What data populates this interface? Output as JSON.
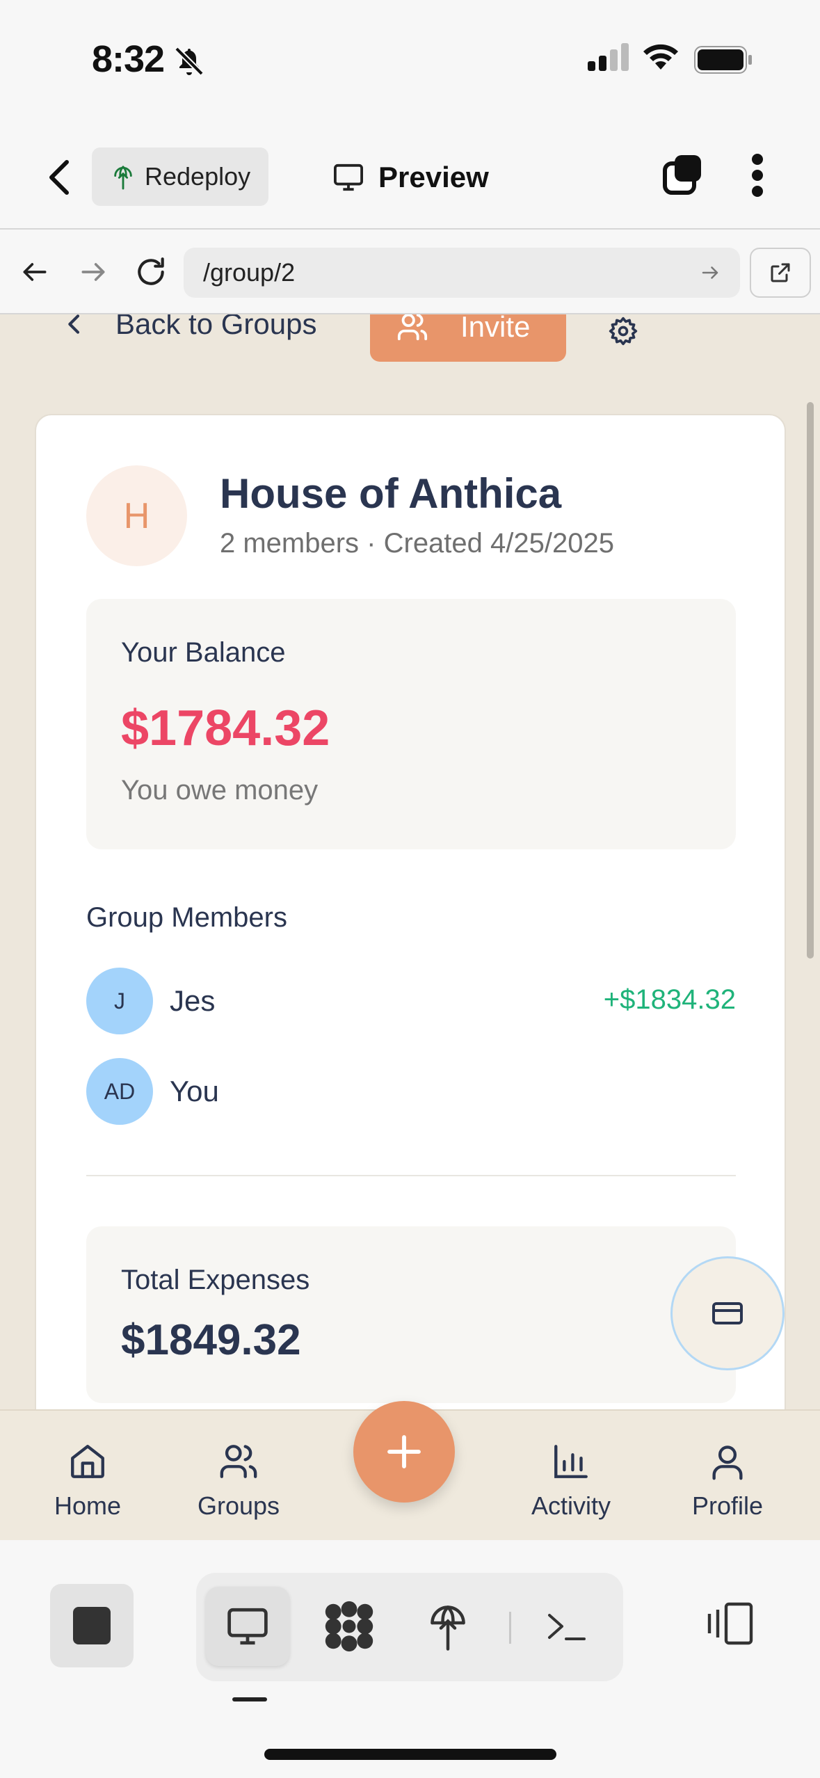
{
  "status_bar": {
    "time": "8:32"
  },
  "app_header": {
    "redeploy_label": "Redeploy",
    "preview_label": "Preview"
  },
  "browser": {
    "url": "/group/2"
  },
  "page": {
    "back_label": "Back to Groups",
    "invite_label": "Invite",
    "group": {
      "initial": "H",
      "name": "House of Anthica",
      "subtitle": "2 members · Created 4/25/2025"
    },
    "balance": {
      "label": "Your Balance",
      "amount": "$1784.32",
      "note": "You owe money",
      "amount_color": "#ec4665"
    },
    "members_title": "Group Members",
    "members": [
      {
        "initials": "J",
        "name": "Jes",
        "balance": "+$1834.32"
      },
      {
        "initials": "AD",
        "name": "You",
        "balance": ""
      }
    ],
    "expenses": {
      "label": "Total Expenses",
      "amount": "$1849.32"
    }
  },
  "bottom_nav": {
    "items": [
      {
        "label": "Home",
        "icon": "home-icon"
      },
      {
        "label": "Groups",
        "icon": "users-icon"
      },
      {
        "label": "Activity",
        "icon": "bar-chart-icon"
      },
      {
        "label": "Profile",
        "icon": "user-icon"
      }
    ],
    "accent": "#e8956a"
  }
}
